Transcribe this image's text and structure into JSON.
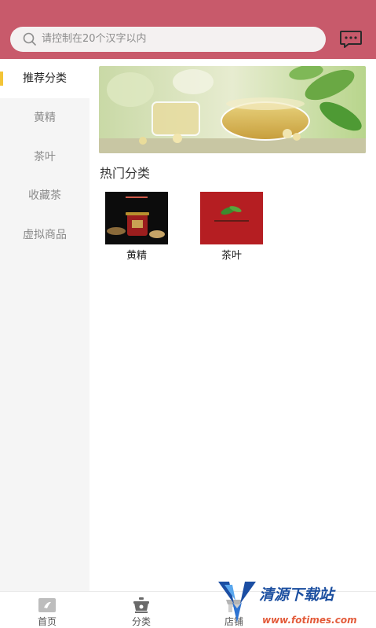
{
  "search": {
    "placeholder": "请控制在20个汉字以内"
  },
  "sidebar": {
    "items": [
      {
        "label": "推荐分类",
        "active": true
      },
      {
        "label": "黄精",
        "active": false
      },
      {
        "label": "茶叶",
        "active": false
      },
      {
        "label": "收藏茶",
        "active": false
      },
      {
        "label": "虚拟商品",
        "active": false
      }
    ]
  },
  "main": {
    "section_title": "热门分类",
    "categories": [
      {
        "label": "黄精"
      },
      {
        "label": "茶叶"
      }
    ]
  },
  "bottom_nav": {
    "items": [
      {
        "label": "首页",
        "icon": "home-icon"
      },
      {
        "label": "分类",
        "icon": "category-icon"
      },
      {
        "label": "店铺",
        "icon": "store-icon"
      }
    ]
  },
  "watermark": {
    "title": "清源下载站",
    "url": "www.fotimes.com"
  },
  "colors": {
    "header": "#c85a6b",
    "accent_bar": "#f3c437",
    "sidebar_bg": "#f5f5f5"
  }
}
